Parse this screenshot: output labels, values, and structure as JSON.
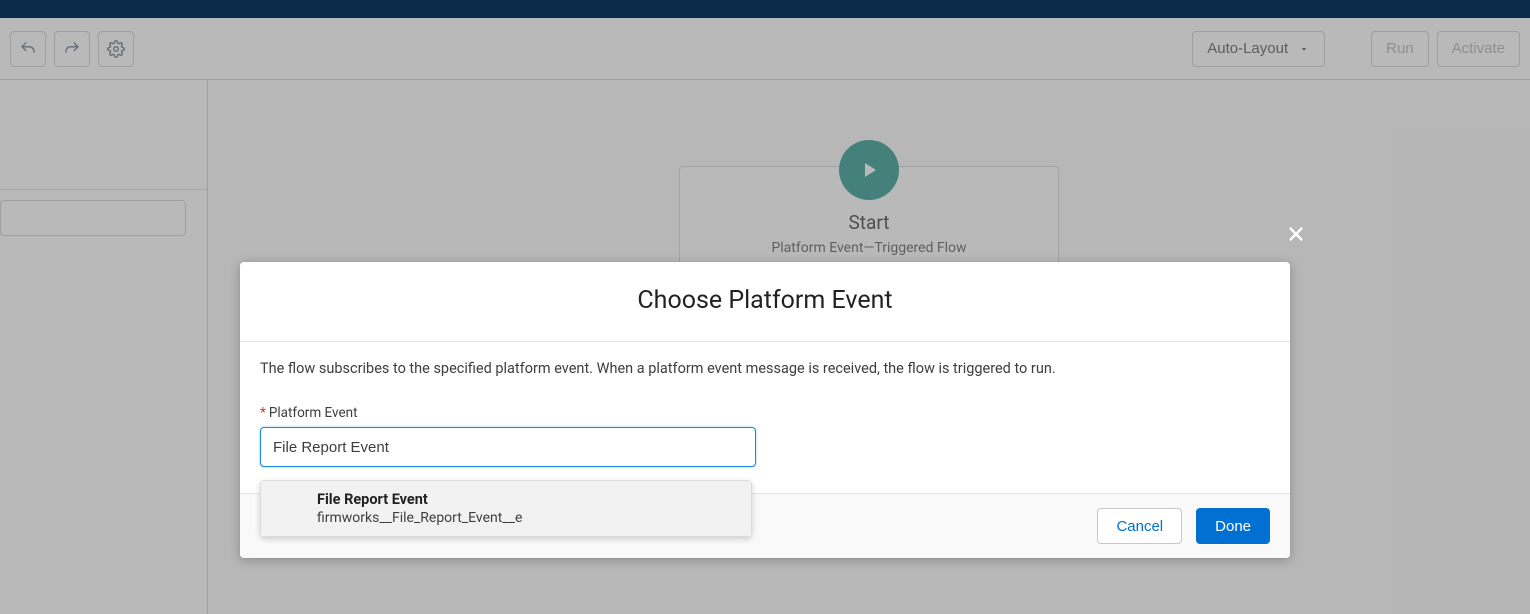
{
  "toolbar": {
    "layout_mode": "Auto-Layout",
    "run_label": "Run",
    "activate_label": "Activate"
  },
  "start_node": {
    "title": "Start",
    "subtitle": "Platform Event—Triggered Flow"
  },
  "modal": {
    "title": "Choose Platform Event",
    "description": "The flow subscribes to the specified platform event. When a platform event message is received, the flow is triggered to run.",
    "field_label": "Platform Event",
    "field_value": "File Report Event",
    "dropdown": {
      "option_label": "File Report Event",
      "option_api": "firmworks__File_Report_Event__e"
    },
    "cancel_label": "Cancel",
    "done_label": "Done"
  }
}
